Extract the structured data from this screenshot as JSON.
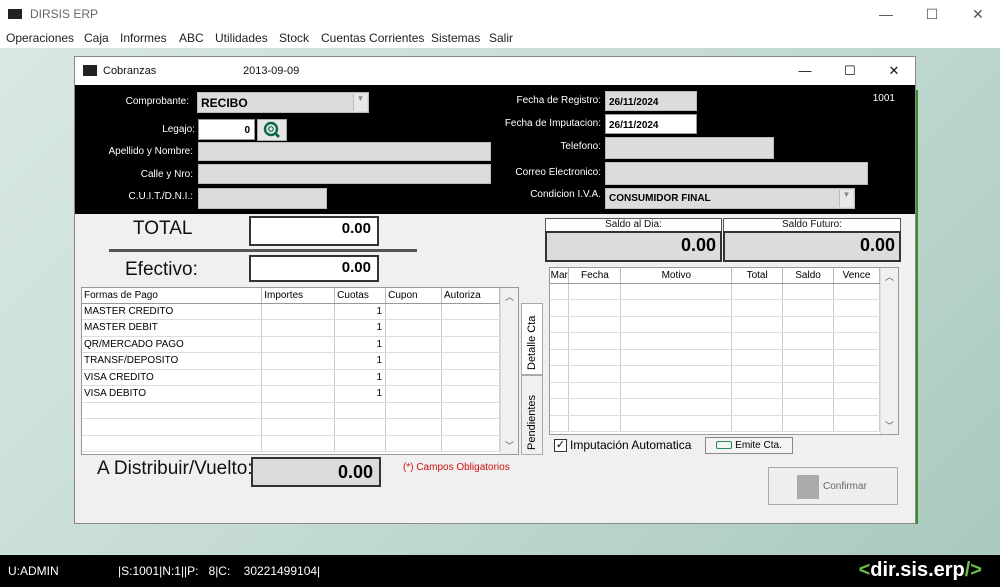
{
  "app": {
    "title": "DIRSIS ERP",
    "minimize": "—",
    "maximize": "☐",
    "close": "✕"
  },
  "menu": [
    "Operaciones",
    "Caja",
    "Informes",
    "ABC",
    "Utilidades",
    "Stock",
    "Cuentas Corrientes",
    "Sistemas",
    "Salir"
  ],
  "window": {
    "title": "Cobranzas",
    "date": "2013-09-09",
    "minimize": "—",
    "maximize": "☐",
    "close": "✕"
  },
  "header": {
    "comprobante_label": "Comprobante:",
    "comprobante_value": "RECIBO",
    "legajo_label": "Legajo:",
    "legajo_value": "0",
    "apellido_label": "Apellido y Nombre:",
    "apellido_value": "",
    "calle_label": "Calle y Nro:",
    "calle_value": "",
    "cuit_label": "C.U.I.T./D.N.I.:",
    "cuit_value": "",
    "fecha_registro_label": "Fecha de Registro:",
    "fecha_registro_value": "26/11/2024",
    "fecha_imputacion_label": "Fecha de Imputacion:",
    "fecha_imputacion_value": "26/11/2024",
    "telefono_label": "Telefono:",
    "telefono_value": "",
    "correo_label": "Correo Electronico:",
    "correo_value": "",
    "condicion_label": "Condicion I.V.A.",
    "condicion_value": "CONSUMIDOR FINAL",
    "number": "1001"
  },
  "totals": {
    "total_label": "TOTAL",
    "total_value": "0.00",
    "efectivo_label": "Efectivo:",
    "efectivo_value": "0.00",
    "distribuir_label": "A Distribuir/Vuelto:",
    "distribuir_value": "0.00"
  },
  "pagos": {
    "columns": [
      "Formas de Pago",
      "Importes",
      "Cuotas",
      "Cupon",
      "Autoriza"
    ],
    "rows": [
      {
        "forma": "MASTER CREDITO",
        "importe": "",
        "cuotas": "1",
        "cupon": "",
        "autoriza": ""
      },
      {
        "forma": "MASTER DEBIT",
        "importe": "",
        "cuotas": "1",
        "cupon": "",
        "autoriza": ""
      },
      {
        "forma": "QR/MERCADO PAGO",
        "importe": "",
        "cuotas": "1",
        "cupon": "",
        "autoriza": ""
      },
      {
        "forma": "TRANSF/DEPOSITO",
        "importe": "",
        "cuotas": "1",
        "cupon": "",
        "autoriza": ""
      },
      {
        "forma": "VISA CREDITO",
        "importe": "",
        "cuotas": "1",
        "cupon": "",
        "autoriza": ""
      },
      {
        "forma": "VISA DEBITO",
        "importe": "",
        "cuotas": "1",
        "cupon": "",
        "autoriza": ""
      }
    ]
  },
  "tabs": {
    "detalle": "Detalle Cta",
    "pendientes": "Pendientes"
  },
  "saldos": {
    "dia_label": "Saldo al Dia:",
    "dia_value": "0.00",
    "futuro_label": "Saldo Futuro:",
    "futuro_value": "0.00"
  },
  "pendientes": {
    "columns": [
      "Mar",
      "Fecha",
      "Motivo",
      "Total",
      "Saldo",
      "Vence"
    ]
  },
  "controls": {
    "imputacion_label": "Imputación Automatica",
    "imputacion_checked": "✓",
    "emite_label": "Emite Cta.",
    "confirm_label": "Confirmar",
    "required_note": "(*) Campos Obligatorios"
  },
  "status": {
    "user": "U:ADMIN",
    "info": "|S:1001|N:1||P:   8|C:    30221499104|",
    "brand_prefix": "<",
    "brand": "dir.sis.erp",
    "brand_suffix": "/>"
  }
}
